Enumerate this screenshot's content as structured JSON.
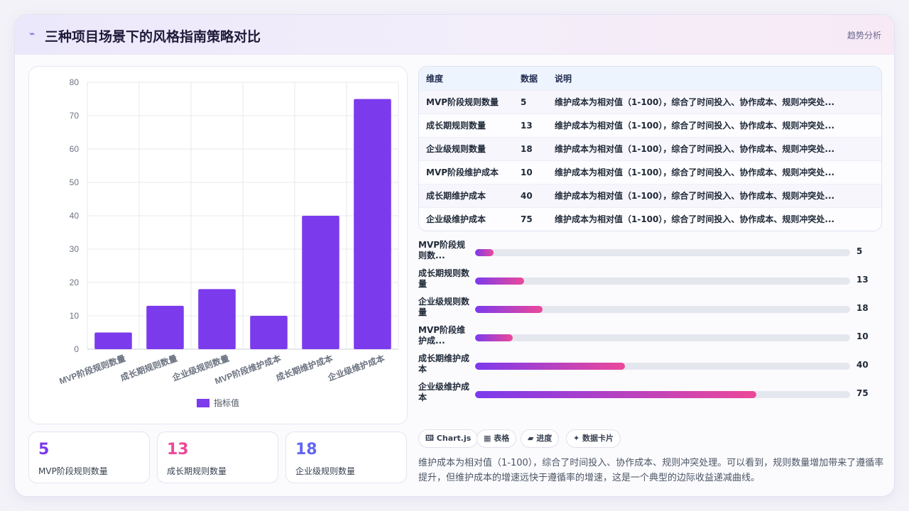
{
  "header": {
    "icon": "pulse-icon",
    "title": "三种项目场景下的风格指南策略对比",
    "right_label": "趋势分析"
  },
  "colors": {
    "bar": "#7c3aed",
    "accent_purple": "#7c3aed",
    "accent_pink": "#ec4899",
    "accent_indigo": "#6366f1"
  },
  "chart_data": {
    "type": "bar",
    "categories": [
      "MVP阶段规则数量",
      "成长期规则数量",
      "企业级规则数量",
      "MVP阶段维护成本",
      "成长期维护成本",
      "企业级维护成本"
    ],
    "series": [
      {
        "name": "指标值",
        "values": [
          5,
          13,
          18,
          10,
          40,
          75
        ]
      }
    ],
    "y_ticks": [
      0,
      10,
      20,
      30,
      40,
      50,
      60,
      70,
      80
    ],
    "ylim": [
      0,
      80
    ],
    "grid": true,
    "legend_position": "bottom"
  },
  "kpis": [
    {
      "value": "5",
      "label": "MVP阶段规则数量",
      "color": "#7c3aed"
    },
    {
      "value": "13",
      "label": "成长期规则数量",
      "color": "#ec4899"
    },
    {
      "value": "18",
      "label": "企业级规则数量",
      "color": "#6366f1"
    }
  ],
  "table": {
    "headers": [
      "维度",
      "数据",
      "说明"
    ],
    "rows": [
      [
        "MVP阶段规则数量",
        "5",
        "维护成本为相对值（1-100），综合了时间投入、协作成本、规则冲突处..."
      ],
      [
        "成长期规则数量",
        "13",
        "维护成本为相对值（1-100），综合了时间投入、协作成本、规则冲突处..."
      ],
      [
        "企业级规则数量",
        "18",
        "维护成本为相对值（1-100），综合了时间投入、协作成本、规则冲突处..."
      ],
      [
        "MVP阶段维护成本",
        "10",
        "维护成本为相对值（1-100），综合了时间投入、协作成本、规则冲突处..."
      ],
      [
        "成长期维护成本",
        "40",
        "维护成本为相对值（1-100），综合了时间投入、协作成本、规则冲突处..."
      ],
      [
        "企业级维护成本",
        "75",
        "维护成本为相对值（1-100），综合了时间投入、协作成本、规则冲突处..."
      ]
    ]
  },
  "progress": {
    "max": 100,
    "items": [
      {
        "label": "MVP阶段规则数...",
        "value": 5
      },
      {
        "label": "成长期规则数量",
        "value": 13
      },
      {
        "label": "企业级规则数量",
        "value": 18
      },
      {
        "label": "MVP阶段维护成...",
        "value": 10
      },
      {
        "label": "成长期维护成本",
        "value": 40
      },
      {
        "label": "企业级维护成本",
        "value": 75
      }
    ]
  },
  "tags": [
    {
      "icon": "chart-icon",
      "text": "🖽 Chart.js"
    },
    {
      "icon": "table-icon",
      "text": "▦ 表格"
    },
    {
      "icon": "progress-icon",
      "text": "▰ 进度"
    },
    {
      "icon": "sparkle-icon",
      "text": "✦ 数据卡片"
    }
  ],
  "description": "维护成本为相对值（1-100），综合了时间投入、协作成本、规则冲突处理。可以看到，规则数量增加带来了遵循率提升，但维护成本的增速远快于遵循率的增速，这是一个典型的边际收益递减曲线。"
}
